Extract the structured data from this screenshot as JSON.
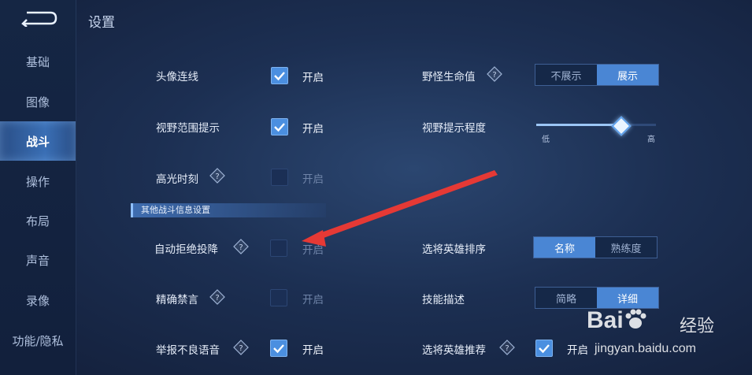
{
  "page_title": "设置",
  "sidebar": {
    "items": [
      {
        "label": "基础"
      },
      {
        "label": "图像"
      },
      {
        "label": "战斗",
        "active": true
      },
      {
        "label": "操作"
      },
      {
        "label": "布局"
      },
      {
        "label": "声音"
      },
      {
        "label": "录像"
      },
      {
        "label": "功能/隐私"
      }
    ]
  },
  "settings": {
    "avatar_line": {
      "label": "头像连线",
      "checked": true,
      "state_text": "开启"
    },
    "view_range_hint": {
      "label": "视野范围提示",
      "checked": true,
      "state_text": "开启"
    },
    "highlight_moment": {
      "label": "高光时刻",
      "checked": false,
      "state_text": "开启"
    },
    "monster_hp": {
      "label": "野怪生命值",
      "options": [
        "不展示",
        "展示"
      ],
      "selected": 1
    },
    "view_hint_level": {
      "label": "视野提示程度",
      "min_label": "低",
      "max_label": "高",
      "value": 0.7
    }
  },
  "section": {
    "title": "其他战斗信息设置"
  },
  "other_settings": {
    "auto_refuse_surrender": {
      "label": "自动拒绝投降",
      "checked": false,
      "state_text": "开启"
    },
    "precise_mute": {
      "label": "精确禁言",
      "checked": false,
      "state_text": "开启"
    },
    "report_bad_voice": {
      "label": "举报不良语音",
      "checked": true,
      "state_text": "开启"
    },
    "hero_sort": {
      "label": "选将英雄排序",
      "options": [
        "名称",
        "熟练度"
      ],
      "selected": 0
    },
    "skill_desc": {
      "label": "技能描述",
      "options": [
        "简略",
        "详细"
      ],
      "selected": 1
    },
    "hero_recommend": {
      "label": "选将英雄推荐",
      "checked": true,
      "state_text": "开启"
    }
  },
  "watermark": {
    "brand": "Bai",
    "brand_cn": "经验",
    "url": "jingyan.baidu.com"
  },
  "colors": {
    "accent": "#4a86d4",
    "active_nav": "#3a6fb5",
    "annotation_arrow": "#e53935"
  }
}
